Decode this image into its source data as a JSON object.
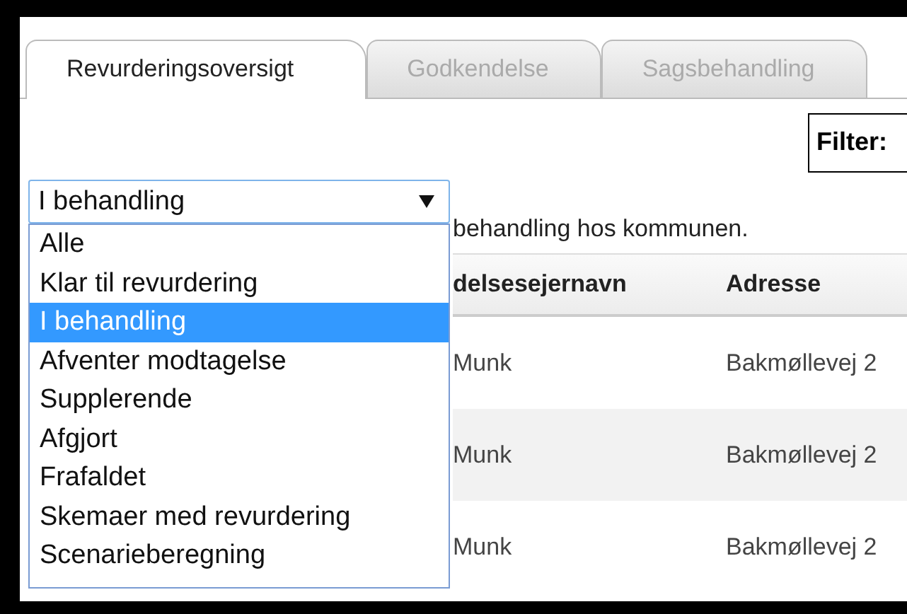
{
  "tabs": [
    {
      "label": "Revurderingsoversigt",
      "selected": true
    },
    {
      "label": "Godkendelse",
      "selected": false
    },
    {
      "label": "Sagsbehandling",
      "selected": false
    }
  ],
  "filter": {
    "label": "Filter:"
  },
  "status_dropdown": {
    "value": "I behandling",
    "expanded": true,
    "options": [
      {
        "label": "Alle",
        "selected": false
      },
      {
        "label": "Klar til revurdering",
        "selected": false
      },
      {
        "label": "I behandling",
        "selected": true
      },
      {
        "label": "Afventer modtagelse",
        "selected": false
      },
      {
        "label": "Supplerende",
        "selected": false
      },
      {
        "label": "Afgjort",
        "selected": false
      },
      {
        "label": "Frafaldet",
        "selected": false
      },
      {
        "label": "Skemaer med revurdering",
        "selected": false
      },
      {
        "label": "Scenarieberegning",
        "selected": false
      }
    ]
  },
  "info_text": "behandling hos kommunen.",
  "table": {
    "columns": [
      "delsesejernavn",
      "Adresse"
    ],
    "rows": [
      [
        "Munk",
        "Bakmøllevej 2"
      ],
      [
        "Munk",
        "Bakmøllevej 2"
      ],
      [
        "Munk",
        "Bakmøllevej 2"
      ]
    ]
  }
}
